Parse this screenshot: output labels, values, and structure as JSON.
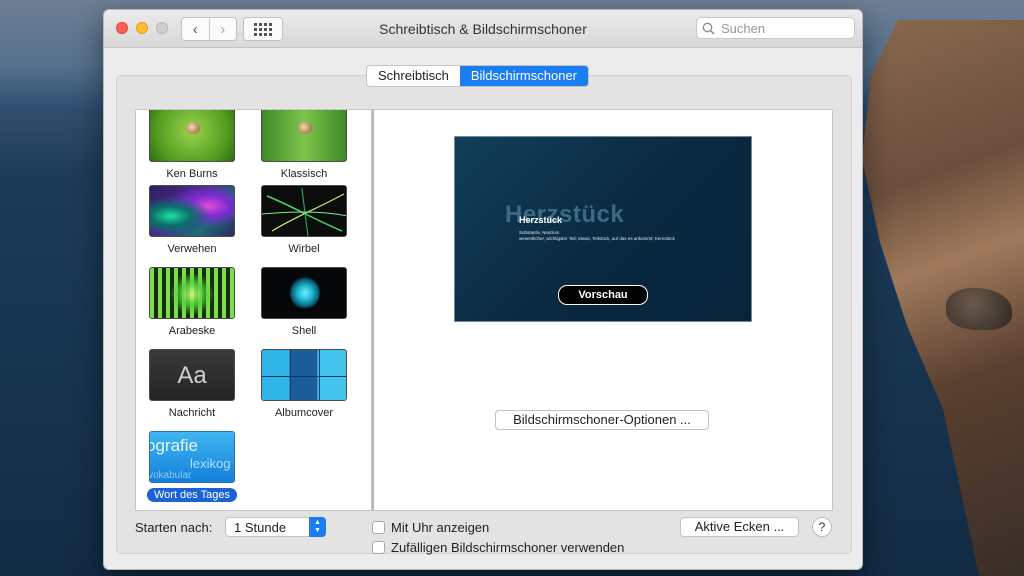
{
  "window": {
    "title": "Schreibtisch & Bildschirmschoner",
    "search_placeholder": "Suchen"
  },
  "tabs": [
    {
      "label": "Schreibtisch",
      "active": false
    },
    {
      "label": "Bildschirmschoner",
      "active": true
    }
  ],
  "screensavers": [
    {
      "label": "Ken Burns",
      "icon": "ken-burns-thumbnail"
    },
    {
      "label": "Klassisch",
      "icon": "klassisch-thumbnail"
    },
    {
      "label": "Verwehen",
      "icon": "verwehen-thumbnail"
    },
    {
      "label": "Wirbel",
      "icon": "wirbel-thumbnail"
    },
    {
      "label": "Arabeske",
      "icon": "arabeske-thumbnail"
    },
    {
      "label": "Shell",
      "icon": "shell-thumbnail"
    },
    {
      "label": "Nachricht",
      "icon": "nachricht-thumbnail",
      "thumb_text": "Aa"
    },
    {
      "label": "Albumcover",
      "icon": "albumcover-thumbnail"
    },
    {
      "label": "Wort des Tages",
      "icon": "wort-des-tages-thumbnail",
      "selected": true,
      "thumb_words": [
        "ografie",
        "lexikog",
        "vokabular"
      ]
    }
  ],
  "preview": {
    "word_big": "Herzstück",
    "word": "Herzstück",
    "subtitle": "Substantiv, Neutrum\nwesentlicher, wichtigster Teil; etwas, Teilstück, auf das es ankommt; Kernstück",
    "button_label": "Vorschau"
  },
  "options_button": "Bildschirmschoner-Optionen ...",
  "footer": {
    "start_after_label": "Starten nach:",
    "start_after_value": "1 Stunde",
    "show_clock_label": "Mit Uhr anzeigen",
    "show_clock_checked": false,
    "random_label": "Zufälligen Bildschirmschoner verwenden",
    "random_checked": false,
    "hot_corners_label": "Aktive Ecken ...",
    "help_label": "?"
  },
  "colors": {
    "accent": "#1a7ef2",
    "selection": "#1a62d6"
  }
}
